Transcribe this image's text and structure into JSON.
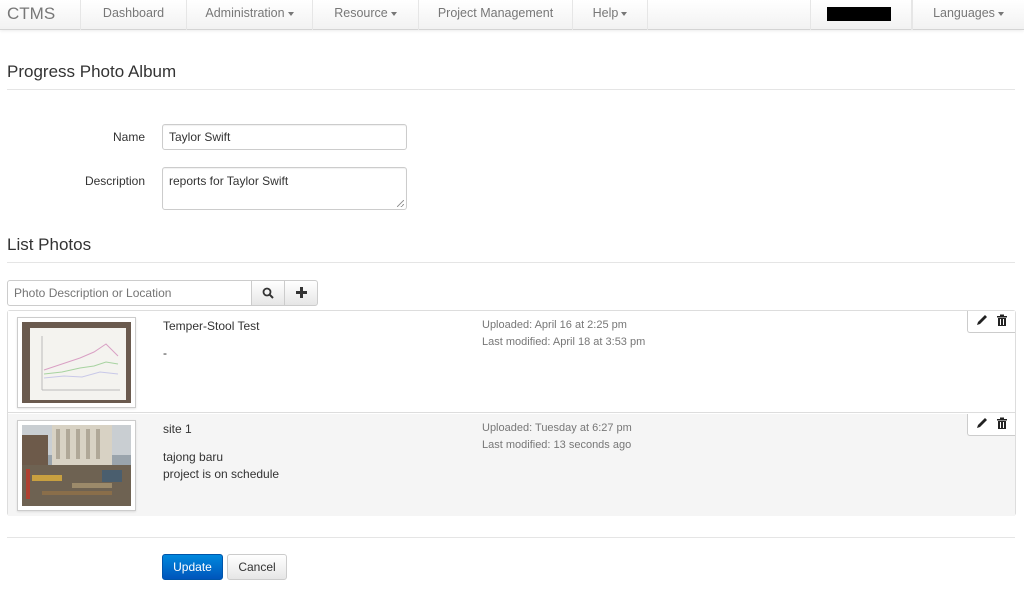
{
  "navbar": {
    "brand": "CTMS",
    "items": [
      {
        "label": "Dashboard",
        "dropdown": false
      },
      {
        "label": "Administration",
        "dropdown": true
      },
      {
        "label": "Resource",
        "dropdown": true
      },
      {
        "label": "Project Management",
        "dropdown": false
      },
      {
        "label": "Help",
        "dropdown": true
      }
    ],
    "languages": "Languages"
  },
  "album": {
    "heading": "Progress Photo Album",
    "name_label": "Name",
    "name_value": "Taylor Swift",
    "description_label": "Description",
    "description_value": "reports for Taylor Swift"
  },
  "photos": {
    "heading": "List Photos",
    "search_placeholder": "Photo Description or Location",
    "items": [
      {
        "title": "Temper-Stool Test",
        "description": [
          "-"
        ],
        "uploaded": "Uploaded: April 16 at 2:25 pm",
        "modified": "Last modified: April 18 at 3:53 pm"
      },
      {
        "title": "site 1",
        "description": [
          "tajong baru",
          "project is on schedule"
        ],
        "uploaded": "Uploaded: Tuesday at 6:27 pm",
        "modified": "Last modified: 13 seconds ago"
      }
    ]
  },
  "actions": {
    "update": "Update",
    "cancel": "Cancel"
  },
  "colors": {
    "primary": "#0066cc",
    "row_alt_bg": "#f5f5f5"
  },
  "icons": {
    "search": "search-icon",
    "add": "plus-icon",
    "edit": "pencil-icon",
    "delete": "trash-icon",
    "dropdown": "caret-down-icon"
  }
}
